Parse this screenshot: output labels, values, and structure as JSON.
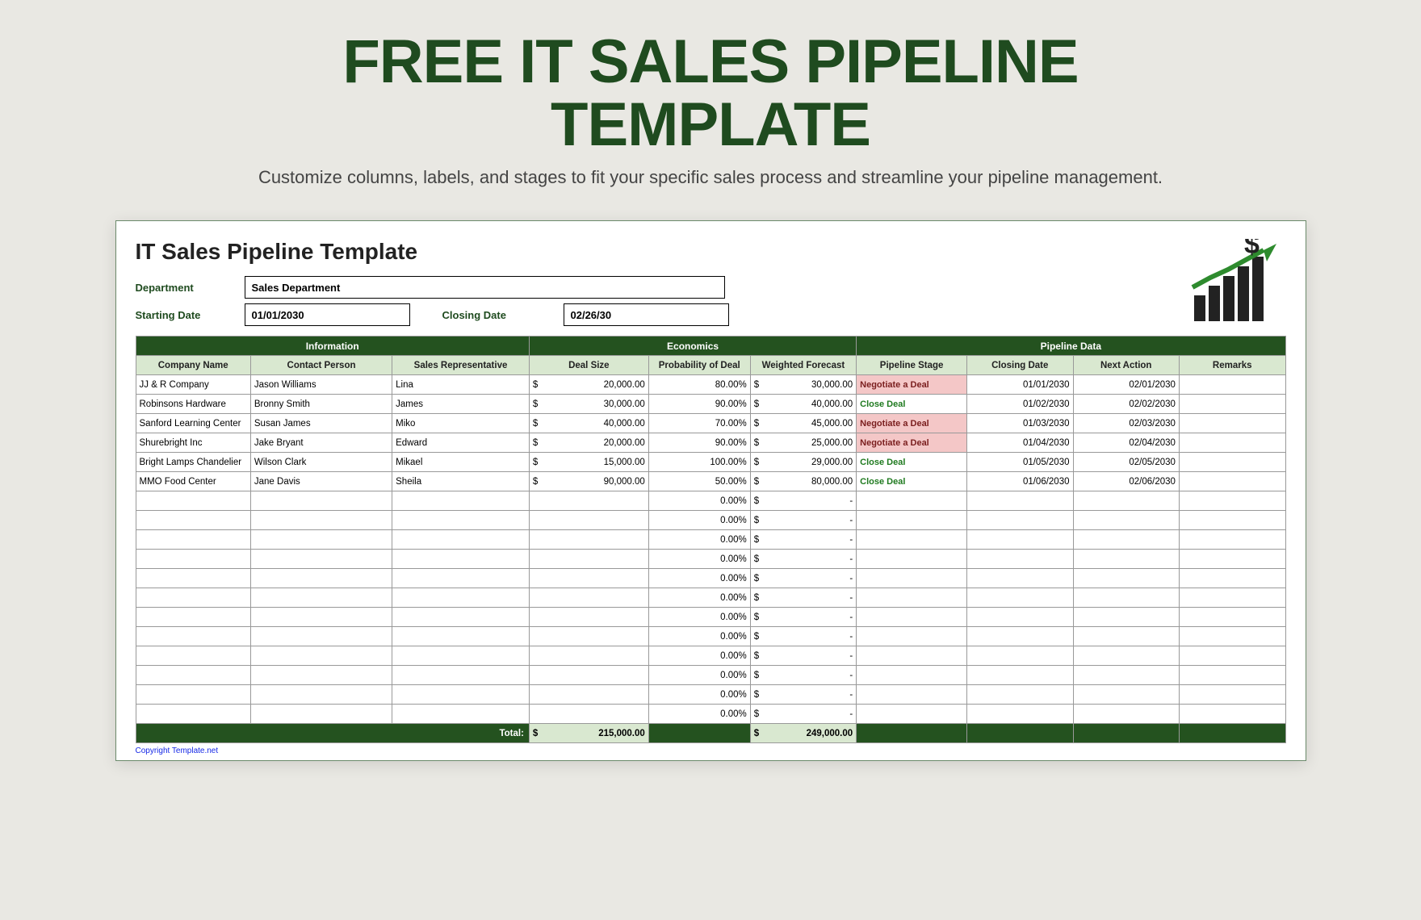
{
  "hero": {
    "title_line1": "FREE IT SALES PIPELINE",
    "title_line2": "TEMPLATE",
    "subtitle": "Customize columns, labels, and stages to fit your specific sales process and streamline your pipeline management."
  },
  "sheet": {
    "title": "IT Sales Pipeline Template",
    "labels": {
      "department": "Department",
      "starting_date": "Starting Date",
      "closing_date": "Closing Date"
    },
    "values": {
      "department": "Sales Department",
      "starting_date": "01/01/2030",
      "closing_date": "02/26/30"
    },
    "copyright": "Copyright Template.net"
  },
  "table": {
    "groups": {
      "information": "Information",
      "economics": "Economics",
      "pipeline": "Pipeline Data"
    },
    "headers": {
      "company": "Company Name",
      "contact": "Contact Person",
      "rep": "Sales Representative",
      "deal": "Deal Size",
      "prob": "Probability of Deal",
      "forecast": "Weighted Forecast",
      "stage": "Pipeline Stage",
      "cdate": "Closing Date",
      "next": "Next Action",
      "remarks": "Remarks"
    },
    "rows": [
      {
        "company": "JJ & R Company",
        "contact": "Jason Williams",
        "rep": "Lina",
        "deal": "20,000.00",
        "prob": "80.00%",
        "forecast": "30,000.00",
        "stage": "Negotiate a Deal",
        "stage_type": "neg",
        "cdate": "01/01/2030",
        "next": "02/01/2030",
        "remarks": ""
      },
      {
        "company": "Robinsons Hardware",
        "contact": "Bronny Smith",
        "rep": "James",
        "deal": "30,000.00",
        "prob": "90.00%",
        "forecast": "40,000.00",
        "stage": "Close Deal",
        "stage_type": "close",
        "cdate": "01/02/2030",
        "next": "02/02/2030",
        "remarks": ""
      },
      {
        "company": "Sanford Learning Center",
        "contact": "Susan James",
        "rep": "Miko",
        "deal": "40,000.00",
        "prob": "70.00%",
        "forecast": "45,000.00",
        "stage": "Negotiate a Deal",
        "stage_type": "neg",
        "cdate": "01/03/2030",
        "next": "02/03/2030",
        "remarks": ""
      },
      {
        "company": "Shurebright Inc",
        "contact": "Jake Bryant",
        "rep": "Edward",
        "deal": "20,000.00",
        "prob": "90.00%",
        "forecast": "25,000.00",
        "stage": "Negotiate a Deal",
        "stage_type": "neg",
        "cdate": "01/04/2030",
        "next": "02/04/2030",
        "remarks": ""
      },
      {
        "company": "Bright Lamps Chandelier",
        "contact": "Wilson Clark",
        "rep": "Mikael",
        "deal": "15,000.00",
        "prob": "100.00%",
        "forecast": "29,000.00",
        "stage": "Close Deal",
        "stage_type": "close",
        "cdate": "01/05/2030",
        "next": "02/05/2030",
        "remarks": ""
      },
      {
        "company": "MMO Food Center",
        "contact": "Jane Davis",
        "rep": "Sheila",
        "deal": "90,000.00",
        "prob": "50.00%",
        "forecast": "80,000.00",
        "stage": "Close Deal",
        "stage_type": "close",
        "cdate": "01/06/2030",
        "next": "02/06/2030",
        "remarks": ""
      }
    ],
    "empty_rows": 12,
    "empty_prob": "0.00%",
    "empty_forecast": "-",
    "currency": "$",
    "total_label": "Total:",
    "totals": {
      "deal": "215,000.00",
      "forecast": "249,000.00"
    }
  }
}
